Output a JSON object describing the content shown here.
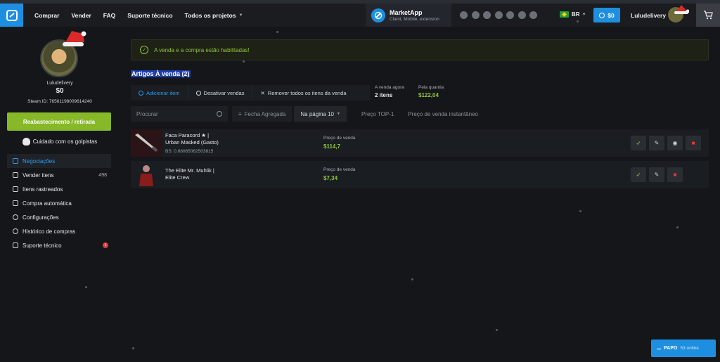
{
  "header": {
    "nav": [
      "Comprar",
      "Vender",
      "FAQ",
      "Suporte técnico",
      "Todos os projetos"
    ],
    "marketapp_title": "MarketApp",
    "marketapp_sub": "Client, Mobile, extension",
    "socials": [
      "x-icon",
      "telegram-icon",
      "youtube-icon",
      "discord-icon",
      "facebook-icon",
      "vk-icon",
      "steam-icon"
    ],
    "language": "BR",
    "balance": "$0",
    "username": "Luludelivery"
  },
  "sidebar": {
    "username": "Luludelivery",
    "balance": "$0",
    "steam_id": "Steam ID: 76561198009614240",
    "refill_label": "Reabastecimento / retirada",
    "scam_label": "Cuidado com os golpistas",
    "items": [
      {
        "label": "Negociações",
        "active": true
      },
      {
        "label": "Vender itens",
        "count": "498"
      },
      {
        "label": "Itens rastreados"
      },
      {
        "label": "Compra automática"
      },
      {
        "label": "Configurações"
      },
      {
        "label": "Histórico de compras"
      },
      {
        "label": "Suporte técnico",
        "badge": "1"
      }
    ]
  },
  "notice": "A venda e a compra estão habilitadas!",
  "section_title": "Artigos À venda (2)",
  "actions": {
    "add": "Adicionar item",
    "disable": "Desativar vendas",
    "remove_all": "Remover todos os itens da venda"
  },
  "stats": {
    "selling_label": "A venda agora",
    "selling_value": "2 itens",
    "quantity_label": "Pela quantia",
    "quantity_value": "$122,04"
  },
  "filters": {
    "search_placeholder": "Procurar",
    "aggregated": "Fecha Agregada",
    "per_page": "Na página 10",
    "top_price": "Preço TOP-1",
    "instant_price": "Preço de venda instantâneo"
  },
  "listings": [
    {
      "name_line1": "Faca Paracord ★ |",
      "name_line2": "Urban Masked (Gasto)",
      "bs": "BS: 0.68085062503815",
      "price_label": "Preço de venda",
      "price": "$114,7"
    },
    {
      "name_line1": "The Elite Mr. Muhlik |",
      "name_line2": "Elite Crew",
      "bs": "",
      "price_label": "Preço de venda",
      "price": "$7,34"
    }
  ],
  "chat": {
    "label": "PAPO",
    "online": "53 online"
  },
  "colors": {
    "accent": "#1e8fe0",
    "green": "#8fc53b",
    "danger": "#e03b3b"
  }
}
